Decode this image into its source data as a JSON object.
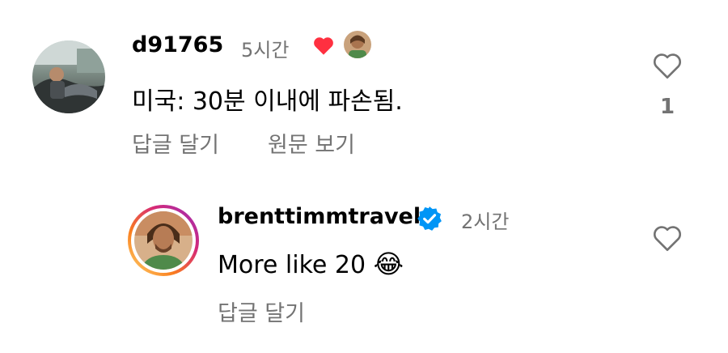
{
  "comments": [
    {
      "username": "d91765",
      "time": "5시간",
      "text": "미국: 30분 이내에 파손됨.",
      "reply_label": "답글 달기",
      "see_original_label": "원문 보기",
      "like_count": "1",
      "liked_by_creator": true
    },
    {
      "username": "brenttimmtravel",
      "verified": true,
      "time": "2시간",
      "text": "More like 20",
      "emoji": "😂",
      "reply_label": "답글 달기"
    }
  ],
  "colors": {
    "secondary_text": "#737373",
    "heart_red": "#ff3040",
    "verified_blue": "#0095f6",
    "story_ring": [
      "#feda75",
      "#fa7e1e",
      "#d62976",
      "#962fbf"
    ]
  }
}
